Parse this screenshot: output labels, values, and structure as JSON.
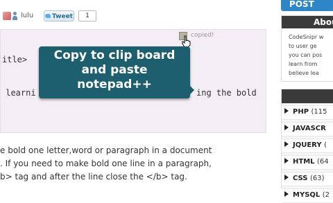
{
  "share": {
    "author": "lulu",
    "tweet_label": "Tweet",
    "tweet_count": "1"
  },
  "code": {
    "line1": "itle>",
    "line2": " learni",
    "line2b": "ing the bold",
    "copied": "copied!"
  },
  "tooltip": {
    "line1": "Copy to clip board",
    "line2": "and paste",
    "line3": "notepad++"
  },
  "article": {
    "line1": "e bold one letter,word or paragraph in a document",
    "line2": ". If you need to make bold one line in a paragraph,",
    "line3": "b> tag and after the line close the </b> tag."
  },
  "sidebar": {
    "post_label": "POST",
    "about_title": "Abou",
    "about_lines": [
      "CodeSnipr w",
      "to user ge",
      "you can pos",
      "learn from",
      "believe lea"
    ],
    "categories": [
      {
        "name": "PHP",
        "count": "(115"
      },
      {
        "name": "JAVASCR",
        "count": ""
      },
      {
        "name": "JQUERY",
        "count": "("
      },
      {
        "name": "HTML",
        "count": "(64"
      },
      {
        "name": "CSS",
        "count": "(63)"
      },
      {
        "name": "MYSQL",
        "count": "(2"
      }
    ]
  },
  "colors": {
    "tooltip_bg": "#1e5f6f",
    "post_bg": "#2e86c7",
    "code_bg": "#f3eef4"
  }
}
